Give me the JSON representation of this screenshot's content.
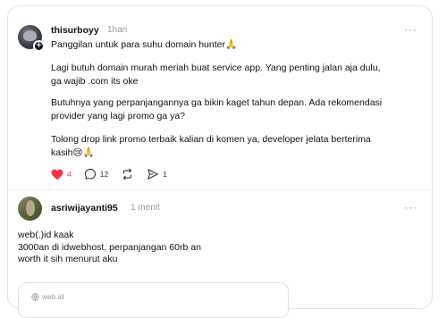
{
  "post": {
    "username": "thisurboyy",
    "time": "1hari",
    "more": "···",
    "title_line": "Panggilan untuk para suhu domain hunter🙏",
    "paragraphs": [
      {
        "lines": [
          "Lagi butuh domain murah meriah buat service app. Yang penting jalan aja dulu,",
          "ga wajib .com its oke"
        ]
      },
      {
        "lines": [
          "Butuhnya yang perpanjangannya ga bikin kaget tahun depan. Ada rekomendasi",
          "provider yang lagi promo ga ya?"
        ]
      },
      {
        "lines": [
          "Tolong drop link promo terbaik kalian di komen ya, developer jelata berterima",
          "kasih😢🙏"
        ]
      }
    ],
    "actions": {
      "likes": "4",
      "comments": "12",
      "repost": "",
      "shares": "1"
    },
    "like_color": "#ff3040"
  },
  "reply": {
    "username": "asriwijayanti95",
    "time": "1 menit",
    "more": "···",
    "lines": [
      "web(.)id kaak",
      "3000an di idwebhost, perpanjangan 60rb an",
      "worth it sih menurut aku"
    ],
    "link_card": {
      "url": "web.id"
    }
  }
}
